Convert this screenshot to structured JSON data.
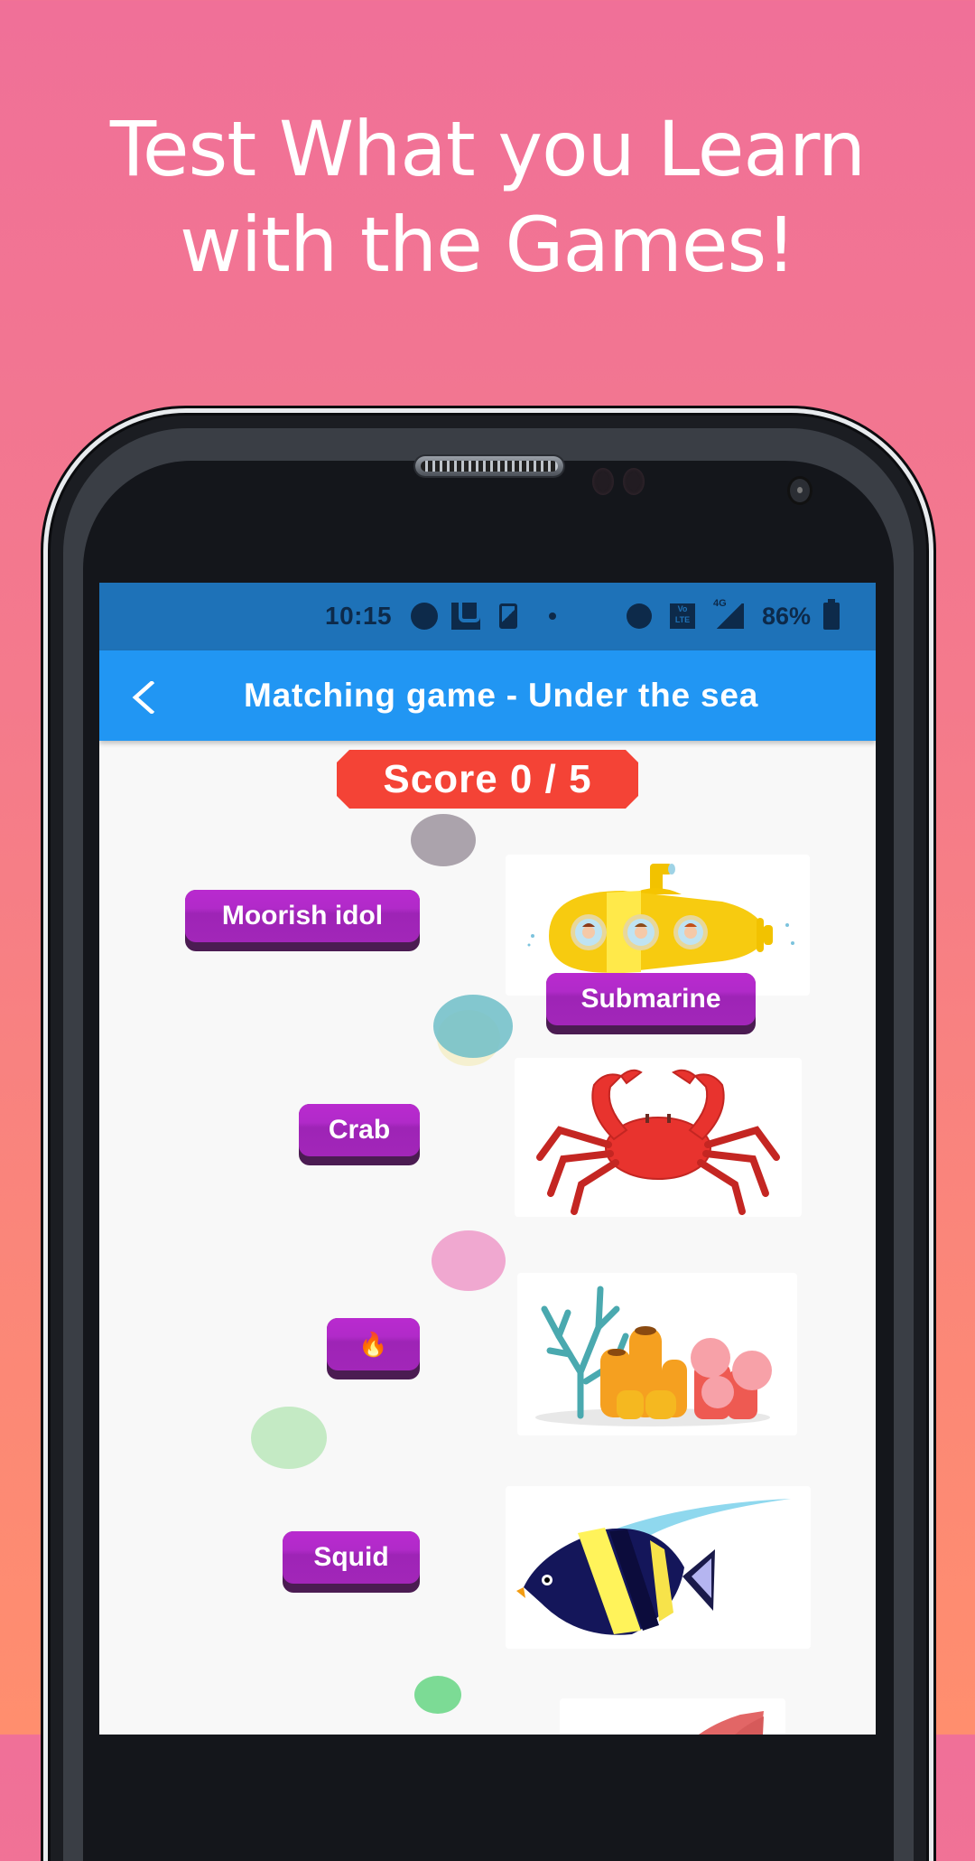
{
  "promo": {
    "headline_line1": "Test What you Learn",
    "headline_line2": "with the Games!"
  },
  "status_bar": {
    "time": "10:15",
    "icons": [
      "app-notification-icon",
      "u-app-icon",
      "tablet-icon",
      "dot-icon",
      "alarm-icon",
      "volte-icon",
      "signal-4g-icon",
      "battery-charging-icon"
    ],
    "volte_label": "Vo LTE",
    "network_label": "4G",
    "battery_percent": "86%"
  },
  "app_bar": {
    "back_icon": "chevron-left-icon",
    "title": "Matching game - Under the sea"
  },
  "score": {
    "label": "Score 0 / 5",
    "current": 0,
    "total": 5
  },
  "word_buttons": [
    {
      "label": "Moorish idol"
    },
    {
      "label": "Submarine"
    },
    {
      "label": "Crab"
    },
    {
      "label": "🔥"
    },
    {
      "label": "Squid"
    }
  ],
  "pictures": [
    {
      "subject": "submarine"
    },
    {
      "subject": "crab"
    },
    {
      "subject": "coral-reef"
    },
    {
      "subject": "moorish-idol-fish"
    },
    {
      "subject": "squid"
    }
  ],
  "colors": {
    "status_bar": "#1E72B8",
    "app_bar": "#2196F3",
    "score_badge": "#F44336",
    "word_button": "#B12AC9",
    "word_button_shadow": "#4B1C52",
    "background_top": "#F07098",
    "background_bottom": "#FF8E6E"
  }
}
